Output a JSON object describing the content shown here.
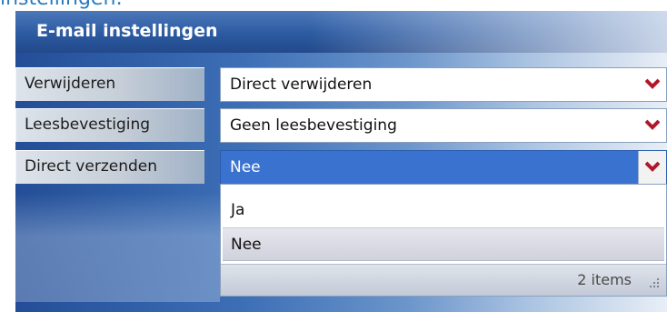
{
  "page": {
    "heading": "instellingen:"
  },
  "panel": {
    "title": "E-mail instellingen"
  },
  "rows": [
    {
      "label": "Verwijderen",
      "value": "Direct verwijderen"
    },
    {
      "label": "Leesbevestiging",
      "value": "Geen leesbevestiging"
    },
    {
      "label": "Direct verzenden",
      "value": "Nee"
    }
  ],
  "dropdown_popup": {
    "options": [
      "Ja",
      "Nee"
    ],
    "selected": "Nee",
    "footer_text": "2 items"
  },
  "colors": {
    "accent": "#3a73cf",
    "chevron": "#b0182a",
    "panel_dark": "#234e97",
    "heading": "#2b7bbf"
  },
  "icons": {
    "dropdown_arrow": "chevron-down-icon",
    "resize": "resize-grip-icon"
  }
}
